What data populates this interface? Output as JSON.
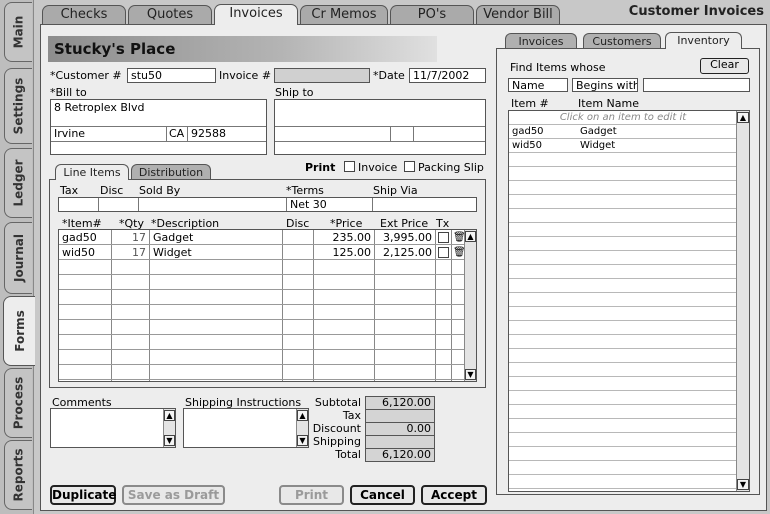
{
  "window_title": "Customer Invoices",
  "side_tabs": [
    "Main",
    "Settings",
    "Ledger",
    "Journal",
    "Forms",
    "Process",
    "Reports"
  ],
  "top_tabs": [
    "Checks",
    "Quotes",
    "Invoices",
    "Cr Memos",
    "PO's",
    "Vendor Bill"
  ],
  "customer_name": "Stucky's Place",
  "form": {
    "customer_label": "*Customer #",
    "customer_value": "stu50",
    "invoice_label": "Invoice #",
    "invoice_value": "",
    "date_label": "*Date",
    "date_value": "11/7/2002",
    "bill_to_label": "*Bill to",
    "ship_to_label": "Ship to",
    "bill_address": "8 Retroplex Blvd",
    "bill_city": "Irvine",
    "bill_state": "CA",
    "bill_zip": "92588"
  },
  "print": {
    "label": "Print",
    "invoice_label": "Invoice",
    "packing_label": "Packing Slip"
  },
  "sub_tabs": [
    "Line Items",
    "Distribution"
  ],
  "terms_row": {
    "tax_label": "Tax",
    "disc_label": "Disc",
    "sold_by_label": "Sold By",
    "terms_label": "*Terms",
    "ship_via_label": "Ship Via",
    "terms_value": "Net 30"
  },
  "line_headers": {
    "item": "*Item#",
    "qty": "*Qty",
    "desc": "*Description",
    "disc": "Disc",
    "price": "*Price",
    "ext": "Ext Price",
    "tx": "Tx"
  },
  "line_items": [
    {
      "item": "gad50",
      "qty": "17",
      "desc": "Gadget",
      "price": "235.00",
      "ext": "3,995.00"
    },
    {
      "item": "wid50",
      "qty": "17",
      "desc": "Widget",
      "price": "125.00",
      "ext": "2,125.00"
    }
  ],
  "comments_label": "Comments",
  "shipping_instructions_label": "Shipping Instructions",
  "totals": {
    "subtotal_label": "Subtotal",
    "subtotal": "6,120.00",
    "tax_label": "Tax",
    "tax": "",
    "discount_label": "Discount",
    "discount": "0.00",
    "shipping_label": "Shipping",
    "shipping": "",
    "total_label": "Total",
    "total": "6,120.00"
  },
  "buttons": {
    "duplicate": "Duplicate",
    "save_draft": "Save as Draft",
    "print": "Print",
    "cancel": "Cancel",
    "accept": "Accept"
  },
  "right_panel": {
    "tabs": [
      "Invoices",
      "Customers",
      "Inventory"
    ],
    "find_label": "Find Items whose",
    "clear": "Clear",
    "field_value": "Name",
    "match_value": "Begins with",
    "search_value": "",
    "col_item": "Item #",
    "col_name": "Item Name",
    "hint": "Click on an item to edit it",
    "items": [
      {
        "id": "gad50",
        "name": "Gadget"
      },
      {
        "id": "wid50",
        "name": "Widget"
      }
    ]
  }
}
